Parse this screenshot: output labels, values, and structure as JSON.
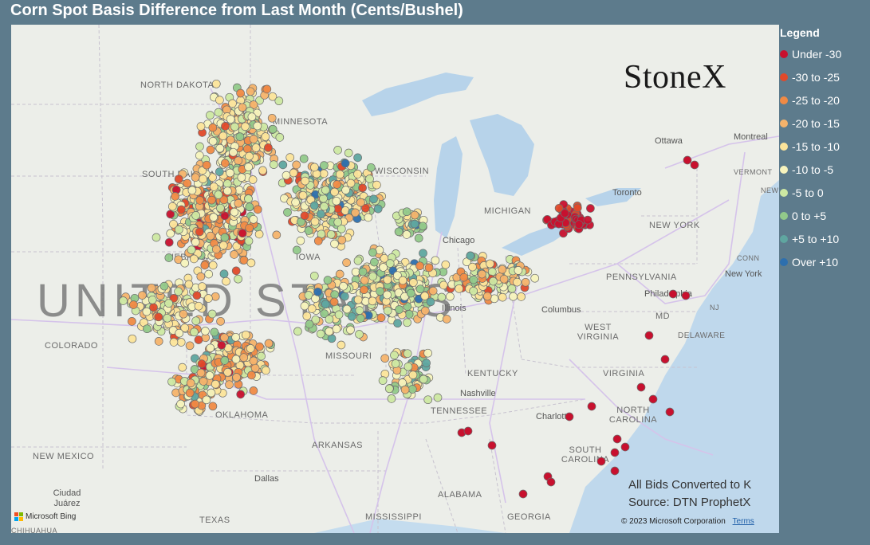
{
  "title": "Corn Spot Basis Difference from Last Month (Cents/Bushel)",
  "legend": {
    "title": "Legend",
    "items": [
      {
        "label": "Under -30",
        "color": "#c8102e"
      },
      {
        "label": "-30 to -25",
        "color": "#e0492a"
      },
      {
        "label": "-25 to -20",
        "color": "#f08a45"
      },
      {
        "label": "-20 to -15",
        "color": "#f5b36b"
      },
      {
        "label": "-15 to -10",
        "color": "#fce49a"
      },
      {
        "label": "-10 to -5",
        "color": "#f7f3bd"
      },
      {
        "label": "-5 to 0",
        "color": "#cde8a2"
      },
      {
        "label": "0 to +5",
        "color": "#92c98a"
      },
      {
        "label": "+5 to +10",
        "color": "#5fa6a0"
      },
      {
        "label": "Over +10",
        "color": "#2d6fae"
      }
    ]
  },
  "map": {
    "country_label": "UNITED STATES",
    "state_labels": [
      "NORTH DAKOTA",
      "MINNESOTA",
      "SOUTH DAKOTA",
      "WISCONSIN",
      "NEBRASKA",
      "IOWA",
      "COLORADO",
      "MISSOURI",
      "OKLAHOMA",
      "ARKANSAS",
      "NEW MEXICO",
      "TEXAS",
      "MISSISSIPPI",
      "ALABAMA",
      "GEORGIA",
      "TENNESSEE",
      "KENTUCKY",
      "WEST VIRGINIA",
      "VIRGINIA",
      "NORTH CAROLINA",
      "SOUTH CAROLINA",
      "PENNSYLVANIA",
      "NEW YORK",
      "MICHIGAN",
      "VERMONT",
      "NEW HAMPSHIRE",
      "CONN",
      "NJ",
      "MD",
      "DELAWARE",
      "CHIHUAHUA"
    ],
    "city_labels": [
      "Chicago",
      "Columbus",
      "Nashville",
      "Charlotte",
      "Dallas",
      "Ciudad Juárez",
      "Toronto",
      "Ottawa",
      "Montreal",
      "New York",
      "Philadelphia",
      "Illinois"
    ],
    "logo": "StoneX",
    "note_lines": [
      "All Bids Converted to K",
      "Source: DTN ProphetX"
    ],
    "attribution": "Microsoft Bing",
    "copyright": "© 2023 Microsoft Corporation",
    "terms": "Terms"
  }
}
